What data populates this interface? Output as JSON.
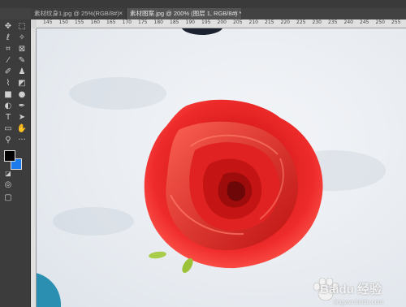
{
  "tabs": [
    {
      "label": "素材纹身1.jpg @ 25%(RGB/8#)",
      "close": "×",
      "active": false
    },
    {
      "label": "素材图案.jpg @ 200% (图层 1, RGB/8#) *",
      "close": "×",
      "active": true
    }
  ],
  "ruler": {
    "ticks": [
      "145",
      "150",
      "155",
      "160",
      "165",
      "170",
      "175",
      "180",
      "185",
      "190",
      "195",
      "200",
      "205",
      "210",
      "215",
      "220",
      "225",
      "230",
      "235",
      "240",
      "245",
      "250",
      "255"
    ]
  },
  "toolbar": {
    "tools": [
      "move-tool",
      "marquee-tool",
      "lasso-tool",
      "magic-wand-tool",
      "crop-tool",
      "frame-tool",
      "eyedropper-tool",
      "ruler-tool",
      "healing-brush-tool",
      "brush-tool",
      "clone-stamp-tool",
      "history-brush-tool",
      "eraser-tool",
      "gradient-tool",
      "blur-tool",
      "dodge-tool",
      "pen-tool",
      "text-tool",
      "path-selection-tool",
      "rectangle-tool",
      "hand-tool",
      "rotate-view-tool",
      "zoom-tool",
      "more-tools"
    ],
    "foreground_color": "#000000",
    "background_color": "#1c7bea"
  },
  "watermark": {
    "text": "Baidu 经验",
    "url": "jingyan.baidu.com"
  }
}
